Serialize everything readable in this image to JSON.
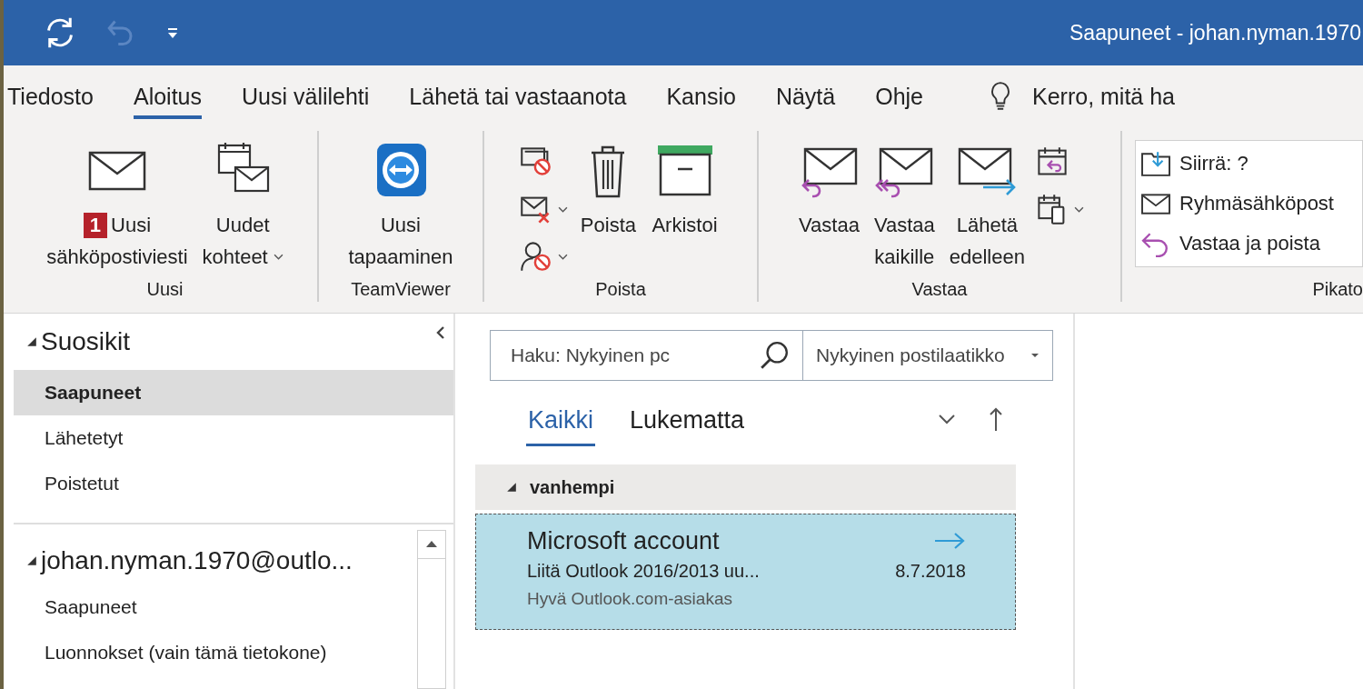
{
  "window": {
    "title": "Saapuneet - johan.nyman.1970",
    "undo_disabled": true
  },
  "tabs": [
    {
      "label": "Tiedosto",
      "selected": false
    },
    {
      "label": "Aloitus",
      "selected": true
    },
    {
      "label": "Uusi välilehti",
      "selected": false
    },
    {
      "label": "Lähetä tai vastaanota",
      "selected": false
    },
    {
      "label": "Kansio",
      "selected": false
    },
    {
      "label": "Näytä",
      "selected": false
    },
    {
      "label": "Ohje",
      "selected": false
    }
  ],
  "tell_me": {
    "label": "Kerro, mitä ha"
  },
  "ribbon": {
    "groups": [
      {
        "label": "Uusi",
        "items": [
          {
            "kind": "large",
            "lines": [
              "Uusi",
              "sähköpostiviesti"
            ],
            "badge": "1",
            "dropdown": false
          },
          {
            "kind": "large",
            "lines": [
              "Uudet",
              "kohteet"
            ],
            "dropdown": true
          }
        ]
      },
      {
        "label": "TeamViewer",
        "items": [
          {
            "kind": "large",
            "lines": [
              "Uusi",
              "tapaaminen"
            ],
            "dropdown": false
          }
        ]
      },
      {
        "label": "Poista",
        "items": [
          {
            "kind": "stack",
            "buttons": [
              {
                "dropdown": false
              },
              {
                "dropdown": true
              },
              {
                "dropdown": true
              }
            ]
          },
          {
            "kind": "large",
            "lines": [
              "Poista"
            ],
            "dropdown": false
          },
          {
            "kind": "large",
            "lines": [
              "Arkistoi"
            ],
            "dropdown": false
          }
        ]
      },
      {
        "label": "Vastaa",
        "items": [
          {
            "kind": "large",
            "lines": [
              "Vastaa"
            ],
            "dropdown": false
          },
          {
            "kind": "large",
            "lines": [
              "Vastaa",
              "kaikille"
            ],
            "dropdown": false
          },
          {
            "kind": "large",
            "lines": [
              "Lähetä",
              "edelleen"
            ],
            "dropdown": false
          },
          {
            "kind": "stack",
            "buttons": [
              {
                "dropdown": false
              },
              {
                "dropdown": true
              }
            ]
          }
        ]
      },
      {
        "label": "Pikato",
        "items": [
          {
            "kind": "quicksteps",
            "steps": [
              "Siirrä: ?",
              "Ryhmäsähköpost",
              "Vastaa ja poista"
            ]
          }
        ]
      }
    ]
  },
  "sidebar": {
    "sections": [
      {
        "title": "Suosikit",
        "expanded": true,
        "items": [
          {
            "label": "Saapuneet",
            "selected": true
          },
          {
            "label": "Lähetetyt",
            "selected": false
          },
          {
            "label": "Poistetut",
            "selected": false
          }
        ]
      },
      {
        "title": "johan.nyman.1970@outlo...",
        "expanded": true,
        "items": [
          {
            "label": "Saapuneet",
            "selected": false
          },
          {
            "label": "Luonnokset (vain tämä tietokone)",
            "selected": false
          }
        ]
      }
    ]
  },
  "search": {
    "placeholder": "Haku: Nykyinen pc",
    "scope": "Nykyinen postilaatikko"
  },
  "filters": [
    {
      "label": "Kaikki",
      "selected": true
    },
    {
      "label": "Lukematta",
      "selected": false
    }
  ],
  "message_groups": [
    {
      "title": "vanhempi",
      "expanded": true,
      "messages": [
        {
          "sender": "Microsoft account",
          "subject": "Liitä Outlook 2016/2013 uu...",
          "preview": "Hyvä Outlook.com-asiakas",
          "date": "8.7.2018",
          "forwarded": true,
          "selected": true
        }
      ]
    }
  ]
}
